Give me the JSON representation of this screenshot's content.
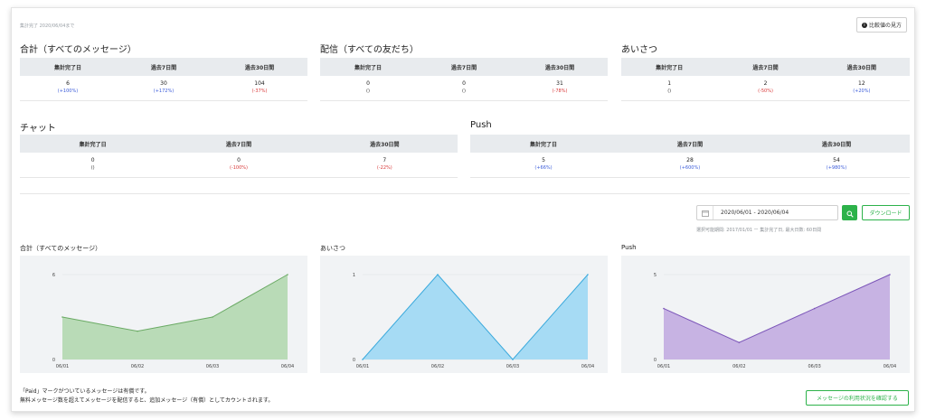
{
  "header": {
    "updated_text": "集計完了 2020/06/04まで",
    "compare_label": "比較値の見方",
    "compare_icon": "info-icon"
  },
  "stats": {
    "column_headers": [
      "集計完了日",
      "過去7日間",
      "過去30日間"
    ],
    "total": {
      "title": "合計（すべてのメッセージ）",
      "values": [
        "6",
        "30",
        "104"
      ],
      "changes": [
        "(+100%)",
        "(+172%)",
        "(-37%)"
      ],
      "change_dirs": [
        "up",
        "up",
        "down"
      ]
    },
    "delivery": {
      "title": "配信（すべての友だち）",
      "values": [
        "0",
        "0",
        "31"
      ],
      "changes": [
        "()",
        "()",
        "(-78%)"
      ],
      "change_dirs": [
        "neutral",
        "neutral",
        "down"
      ]
    },
    "greeting": {
      "title": "あいさつ",
      "values": [
        "1",
        "2",
        "12"
      ],
      "changes": [
        "()",
        "(-50%)",
        "(+20%)"
      ],
      "change_dirs": [
        "neutral",
        "down",
        "up"
      ]
    },
    "chat": {
      "title": "チャット",
      "values": [
        "0",
        "0",
        "7"
      ],
      "changes": [
        "()",
        "(-100%)",
        "(-22%)"
      ],
      "change_dirs": [
        "neutral",
        "down",
        "down"
      ]
    },
    "push": {
      "title": "Push",
      "values": [
        "5",
        "28",
        "54"
      ],
      "changes": [
        "(+66%)",
        "(+600%)",
        "(+980%)"
      ],
      "change_dirs": [
        "up",
        "up",
        "up"
      ]
    }
  },
  "filter": {
    "date_range": "2020/06/01 - 2020/06/04",
    "calendar_icon": "calendar-icon",
    "search_icon": "search-icon",
    "download_label": "ダウンロード",
    "range_note": "選択可能期間: 2017/01/01 ー 集計完了日, 最大日数: 60日間"
  },
  "chart_data": [
    {
      "type": "area",
      "title": "合計（すべてのメッセージ）",
      "x": [
        "06/01",
        "06/02",
        "06/03",
        "06/04"
      ],
      "values": [
        3,
        2,
        3,
        6
      ],
      "ylim": [
        0,
        6
      ],
      "yticks": [
        "0",
        "6"
      ],
      "color": "#b9dbb7",
      "line_color": "#6aaa64"
    },
    {
      "type": "area",
      "title": "あいさつ",
      "x": [
        "06/01",
        "06/02",
        "06/03",
        "06/04"
      ],
      "values": [
        0,
        1,
        0,
        1
      ],
      "ylim": [
        0,
        1
      ],
      "yticks": [
        "0",
        "1"
      ],
      "color": "#a6dbf4",
      "line_color": "#3aa9dc"
    },
    {
      "type": "area",
      "title": "Push",
      "x": [
        "06/01",
        "06/02",
        "06/03",
        "06/04"
      ],
      "values": [
        3,
        1,
        3,
        5
      ],
      "ylim": [
        0,
        5
      ],
      "yticks": [
        "0",
        "5"
      ],
      "color": "#c7b3e3",
      "line_color": "#7b55b8"
    }
  ],
  "footer": {
    "note_line1": "「Paid」マークがついているメッセージは有償です。",
    "note_line2": "無料メッセージ数を超えてメッセージを配信すると、追加メッセージ（有償）としてカウントされます。",
    "confirm_label": "メッセージの利用状況を確認する"
  }
}
